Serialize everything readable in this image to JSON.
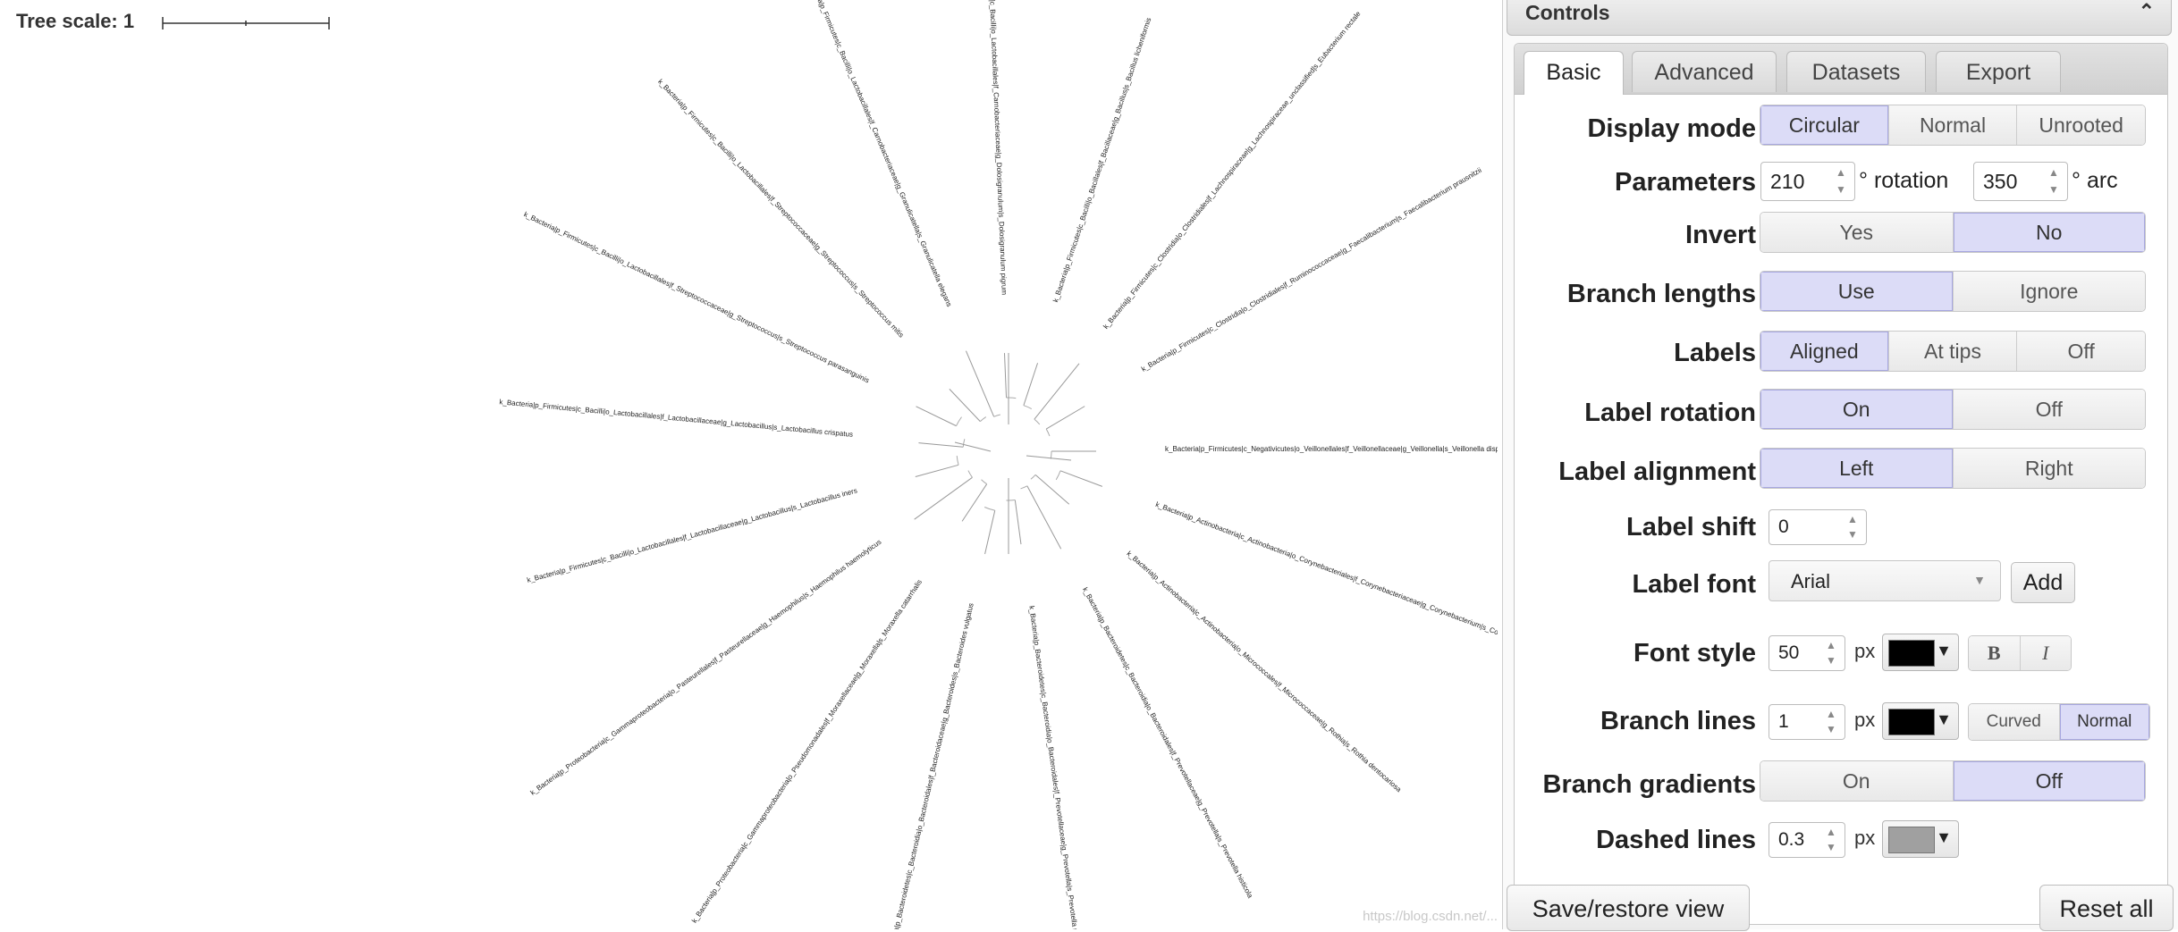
{
  "canvas": {
    "scale_label": "Tree scale: 1",
    "watermark": "https://blog.csdn.net/...",
    "leaves": [
      {
        "label": "k_Bacteria|p_Firmicutes|c_Negativicutes|o_Veillonellales|f_Veillonellaceae|g_Veillonella|s_Veillonella dispar"
      },
      {
        "label": "k_Bacteria|p_Actinobacteria|c_Actinobacteria|o_Corynebacteriales|f_Corynebacteriaceae|g_Corynebacterium|s_Corynebacterium matruchotii"
      },
      {
        "label": "k_Bacteria|p_Actinobacteria|c_Actinobacteria|o_Micrococcales|f_Micrococcaceae|g_Rothia|s_Rothia dentocariosa"
      },
      {
        "label": "k_Bacteria|p_Bacteroidetes|c_Bacteroidia|o_Bacteroidales|f_Prevotellaceae|g_Prevotella|s_Prevotella histicola"
      },
      {
        "label": "k_Bacteria|p_Bacteroidetes|c_Bacteroidia|o_Bacteroidales|f_Prevotellaceae|g_Prevotella|s_Prevotella pallens"
      },
      {
        "label": "k_Bacteria|p_Bacteroidetes|c_Bacteroidia|o_Bacteroidales|f_Bacteroidaceae|g_Bacteroides|s_Bacteroides vulgatus"
      },
      {
        "label": "k_Bacteria|p_Proteobacteria|c_Gammaproteobacteria|o_Pseudomonadales|f_Moraxellaceae|g_Moraxella|s_Moraxella catarrhalis"
      },
      {
        "label": "k_Bacteria|p_Proteobacteria|c_Gammaproteobacteria|o_Pasteurellales|f_Pasteurellaceae|g_Haemophilus|s_Haemophilus haemolyticus"
      },
      {
        "label": "k_Bacteria|p_Firmicutes|c_Bacilli|o_Lactobacillales|f_Lactobacillaceae|g_Lactobacillus|s_Lactobacillus iners"
      },
      {
        "label": "k_Bacteria|p_Firmicutes|c_Bacilli|o_Lactobacillales|f_Lactobacillaceae|g_Lactobacillus|s_Lactobacillus crispatus"
      },
      {
        "label": "k_Bacteria|p_Firmicutes|c_Bacilli|o_Lactobacillales|f_Streptococcaceae|g_Streptococcus|s_Streptococcus parasanguinis"
      },
      {
        "label": "k_Bacteria|p_Firmicutes|c_Bacilli|o_Lactobacillales|f_Streptococcaceae|g_Streptococcus|s_Streptococcus mitis"
      },
      {
        "label": "k_Bacteria|p_Firmicutes|c_Bacilli|o_Lactobacillales|f_Carnobacteriaceae|g_Granulicatella|s_Granulicatella elegans"
      },
      {
        "label": "k_Bacteria|p_Firmicutes|c_Bacilli|o_Lactobacillales|f_Carnobacteriaceae|g_Dolosigranulum|s_Dolosigranulum pigrum"
      },
      {
        "label": "k_Bacteria|p_Firmicutes|c_Bacilli|o_Bacillales|f_Bacillaceae|g_Bacillus|s_Bacillus licheniformis"
      },
      {
        "label": "k_Bacteria|p_Firmicutes|c_Clostridia|o_Clostridiales|f_Lachnospiraceae|g_Lachnospiraceae_unclassified|s_Eubacterium rectale"
      },
      {
        "label": "k_Bacteria|p_Firmicutes|c_Clostridia|o_Clostridiales|f_Ruminococcaceae|g_Faecalibacterium|s_Faecalibacterium prausnitzii"
      }
    ]
  },
  "panel": {
    "title": "Controls",
    "collapse_icon": "chevron-up-icon",
    "tabs": [
      "Basic",
      "Advanced",
      "Datasets",
      "Export"
    ],
    "active_tab": "Basic",
    "display_mode": {
      "label": "Display mode",
      "options": [
        "Circular",
        "Normal",
        "Unrooted"
      ],
      "selected": "Circular"
    },
    "parameters": {
      "label": "Parameters",
      "rotation_value": "210",
      "rotation_unit": "° rotation",
      "arc_value": "350",
      "arc_unit": "° arc"
    },
    "invert": {
      "label": "Invert",
      "options": [
        "Yes",
        "No"
      ],
      "selected": "No"
    },
    "branch_lengths": {
      "label": "Branch lengths",
      "options": [
        "Use",
        "Ignore"
      ],
      "selected": "Use"
    },
    "labels": {
      "label": "Labels",
      "options": [
        "Aligned",
        "At tips",
        "Off"
      ],
      "selected": "Aligned"
    },
    "label_rotation": {
      "label": "Label rotation",
      "options": [
        "On",
        "Off"
      ],
      "selected": "On"
    },
    "label_alignment": {
      "label": "Label alignment",
      "options": [
        "Left",
        "Right"
      ],
      "selected": "Left"
    },
    "label_shift": {
      "label": "Label shift",
      "value": "0"
    },
    "label_font": {
      "label": "Label font",
      "value": "Arial",
      "add_label": "Add"
    },
    "font_style": {
      "label": "Font style",
      "size": "50",
      "unit": "px",
      "color": "#000000",
      "bold": "B",
      "italic": "I"
    },
    "branch_lines": {
      "label": "Branch lines",
      "width": "1",
      "unit": "px",
      "color": "#000000",
      "options": [
        "Curved",
        "Normal"
      ],
      "selected": "Normal"
    },
    "branch_gradients": {
      "label": "Branch gradients",
      "options": [
        "On",
        "Off"
      ],
      "selected": "Off"
    },
    "dashed_lines": {
      "label": "Dashed lines",
      "width": "0.3",
      "unit": "px",
      "color": "#a0a0a0"
    },
    "save_restore_label": "Save/restore view",
    "reset_label": "Reset all"
  },
  "colors": {
    "selected_segment": "#dcdcf7",
    "panel_bg": "#fafafa"
  }
}
